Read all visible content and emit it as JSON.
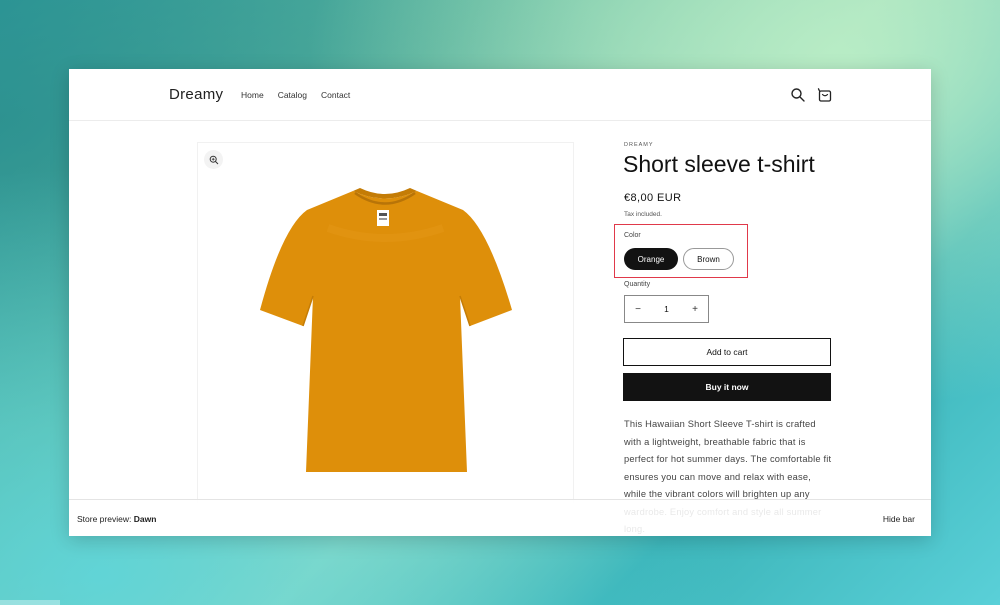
{
  "header": {
    "brand": "Dreamy",
    "nav": [
      "Home",
      "Catalog",
      "Contact"
    ],
    "icons": [
      "search-icon",
      "cart-icon"
    ]
  },
  "media": {
    "icons": [
      "zoom-icon"
    ],
    "image_color": "#de8f0a"
  },
  "product": {
    "vendor": "DREAMY",
    "title": "Short sleeve t-shirt",
    "price": "€8,00 EUR",
    "tax": "Tax included.",
    "color_label": "Color",
    "colors": [
      "Orange",
      "Brown"
    ],
    "selected_color": "Orange",
    "quantity_label": "Quantity",
    "quantity": "1",
    "add_to_cart": "Add to cart",
    "buy_now": "Buy it now",
    "description": "This Hawaiian Short Sleeve T-shirt is crafted with a lightweight, breathable fabric that is perfect for hot summer days. The comfortable fit ensures you can move and relax with ease, while the vibrant colors will brighten up any wardrobe. Enjoy comfort and style all summer long."
  },
  "preview_bar": {
    "label": "Store preview:",
    "theme": "Dawn",
    "hide": "Hide bar"
  },
  "colors": {
    "highlight": "#e0394a",
    "primary": "#121212"
  }
}
